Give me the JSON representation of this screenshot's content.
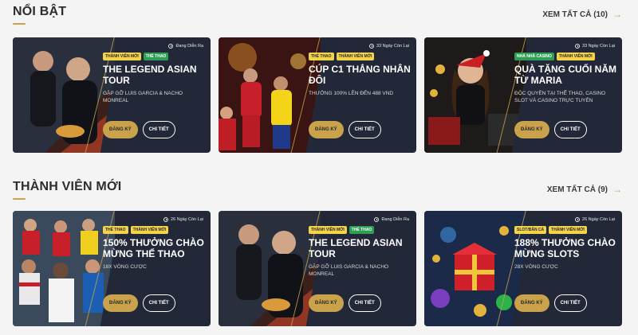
{
  "sections": [
    {
      "title": "NỔI BẬT",
      "see_all": "XEM TẤT CẢ (10)",
      "cards": [
        {
          "tags": [
            {
              "text": "THÀNH VIÊN MỚI",
              "color": "yellow"
            },
            {
              "text": "THỂ THAO",
              "color": "green"
            }
          ],
          "status": "Đang Diễn Ra",
          "title": "THE LEGEND ASIAN TOUR",
          "desc": "GẶP GỠ LUIS GARCIA & NACHO MONREAL",
          "register": "ĐĂNG KÝ",
          "detail": "CHI TIẾT"
        },
        {
          "tags": [
            {
              "text": "THỂ THAO",
              "color": "yellow"
            },
            {
              "text": "THÀNH VIÊN MỚI",
              "color": "yellow"
            }
          ],
          "status": "33 Ngày Còn Lại",
          "title": "CÚP C1 THẮNG NHÂN ĐÔI",
          "desc": "THƯỞNG 100% LÊN ĐẾN 488 VND",
          "register": "ĐĂNG KÝ",
          "detail": "CHI TIẾT"
        },
        {
          "tags": [
            {
              "text": "NHÀ NHÀ CASINO",
              "color": "green"
            },
            {
              "text": "THÀNH VIÊN MỚI",
              "color": "yellow"
            }
          ],
          "status": "33 Ngày Còn Lại",
          "title": "QUÀ TẶNG CUỐI NĂM TỪ MARIA",
          "desc": "ĐỘC QUYỀN TẠI THỂ THAO, CASINO SLOT VÀ CASINO TRỰC TUYẾN",
          "register": "ĐĂNG KÝ",
          "detail": "CHI TIẾT"
        }
      ]
    },
    {
      "title": "THÀNH VIÊN MỚI",
      "see_all": "XEM TẤT CẢ (9)",
      "cards": [
        {
          "tags": [
            {
              "text": "THỂ THAO",
              "color": "yellow"
            },
            {
              "text": "THÀNH VIÊN MỚI",
              "color": "yellow"
            }
          ],
          "status": "26 Ngày Còn Lại",
          "title": "150% THƯỞNG CHÀO MỪNG THỂ THAO",
          "desc": "18X VÒNG CƯỢC",
          "register": "ĐĂNG KÝ",
          "detail": "CHI TIẾT"
        },
        {
          "tags": [
            {
              "text": "THÀNH VIÊN MỚI",
              "color": "yellow"
            },
            {
              "text": "THỂ THAO",
              "color": "green"
            }
          ],
          "status": "Đang Diễn Ra",
          "title": "THE LEGEND ASIAN TOUR",
          "desc": "GẶP GỠ LUIS GARCIA & NACHO MONREAL",
          "register": "ĐĂNG KÝ",
          "detail": "CHI TIẾT"
        },
        {
          "tags": [
            {
              "text": "SLOT/BẮN CÁ",
              "color": "yellow"
            },
            {
              "text": "THÀNH VIÊN MỚI",
              "color": "yellow"
            }
          ],
          "status": "26 Ngày Còn Lại",
          "title": "188% THƯỞNG CHÀO MỪNG SLOTS",
          "desc": "28X VÒNG CƯỢC",
          "register": "ĐĂNG KÝ",
          "detail": "CHI TIẾT"
        }
      ]
    }
  ],
  "colors": {
    "accent": "#c9a24b",
    "card_bg": "#232838",
    "tag_yellow": "#f2d34a",
    "tag_green": "#2e9e55"
  }
}
